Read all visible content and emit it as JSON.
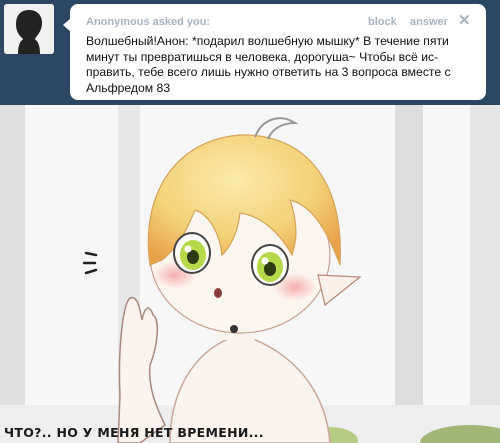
{
  "ask": {
    "asker": "Anonymous asked you:",
    "block_label": "block",
    "answer_label": "answer",
    "close_label": "✕",
    "question": "Волшебный!Анон: *подарил волшебную мышку* В течение пяти минут ты превратишься в человека, дорогуша~ Чтобы всё ис-править, тебе всего лишь нужно ответить на 3 вопроса вместе с Альфредом 83"
  },
  "illustration": {
    "caption": "ЧТО?.. НО У МЕНЯ НЕТ ВРЕМЕНИ..."
  },
  "colors": {
    "ask_background": "#2c4762",
    "meta_text": "#a8b4c0",
    "hair": "#f3d27a",
    "eyes": "#b6d94a",
    "blush": "#f3a0a0"
  }
}
